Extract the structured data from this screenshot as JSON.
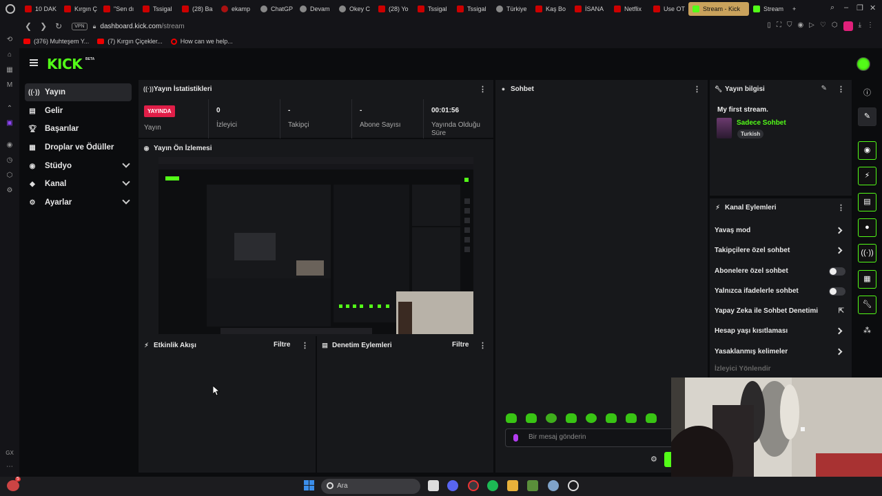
{
  "browser": {
    "tabs": [
      {
        "label": "10 DAK",
        "fav": "youtube"
      },
      {
        "label": "Kırgın Ç",
        "fav": "youtube"
      },
      {
        "label": "\"Sen dı",
        "fav": "youtube"
      },
      {
        "label": "Tssigal",
        "fav": "youtube"
      },
      {
        "label": "(28) Ba",
        "fav": "youtube"
      },
      {
        "label": "ekamp",
        "fav": "dark"
      },
      {
        "label": "ChatGP",
        "fav": "grey"
      },
      {
        "label": "Devam",
        "fav": "google"
      },
      {
        "label": "Okey C",
        "fav": "grey"
      },
      {
        "label": "(28) Yo",
        "fav": "youtube"
      },
      {
        "label": "Tssigal",
        "fav": "youtube"
      },
      {
        "label": "Tssigal",
        "fav": "youtube"
      },
      {
        "label": "Türkiye",
        "fav": "grey"
      },
      {
        "label": "Kaş Bo",
        "fav": "red"
      },
      {
        "label": "İSANA",
        "fav": "red"
      },
      {
        "label": "Netflix",
        "fav": "red"
      },
      {
        "label": "Use OT",
        "fav": "gmail"
      }
    ],
    "active_tab": "Stream - Kick",
    "extra_tab": "Stream",
    "vpn_label": "VPN",
    "url_domain": "dashboard.kick.com",
    "url_path": "/stream",
    "bookmarks": [
      {
        "label": "(376) Muhteşem Y..."
      },
      {
        "label": "(7) Kırgın Çiçekler..."
      },
      {
        "label": "How can we help..."
      }
    ]
  },
  "header": {
    "logo": "KICK",
    "beta": "BETA"
  },
  "nav": {
    "items": [
      {
        "label": "Yayın",
        "icon": "broadcast-icon"
      },
      {
        "label": "Gelir",
        "icon": "revenue-icon"
      },
      {
        "label": "Başarılar",
        "icon": "trophy-icon"
      },
      {
        "label": "Droplar ve Ödüller",
        "icon": "gift-icon"
      },
      {
        "label": "Stüdyo",
        "icon": "studio-icon"
      },
      {
        "label": "Kanal",
        "icon": "channel-icon"
      },
      {
        "label": "Ayarlar",
        "icon": "settings-icon"
      }
    ]
  },
  "stats": {
    "title": "Yayın İstatistikleri",
    "live_badge": "YAYINDA",
    "live_label": "Yayın",
    "viewers_value": "0",
    "viewers_label": "İzleyici",
    "followers_value": "-",
    "followers_label": "Takipçi",
    "subs_value": "-",
    "subs_label": "Abone Sayısı",
    "duration_value": "00:01:56",
    "duration_label": "Yayında Olduğu Süre"
  },
  "preview": {
    "title": "Yayın Ön İzlemesi"
  },
  "activity": {
    "title": "Etkinlik Akışı",
    "filter": "Filtre"
  },
  "moderation": {
    "title": "Denetim Eylemleri",
    "filter": "Filtre"
  },
  "chat": {
    "title": "Sohbet",
    "placeholder": "Bir mesaj gönderin"
  },
  "stream_info": {
    "title": "Yayın bilgisi",
    "stream_title": "My first stream.",
    "category": "Sadece Sohbet",
    "tag": "Turkish",
    "category_color": "#53fc18"
  },
  "channel_actions": {
    "title": "Kanal Eylemleri",
    "rows": [
      {
        "label": "Yavaş mod",
        "control": "arrow"
      },
      {
        "label": "Takipçilere özel sohbet",
        "control": "arrow"
      },
      {
        "label": "Abonelere özel sohbet",
        "control": "toggle"
      },
      {
        "label": "Yalnızca ifadelerle sohbet",
        "control": "toggle"
      },
      {
        "label": "Yapay Zeka ile Sohbet Denetimi",
        "control": "external"
      },
      {
        "label": "Hesap yaşı kısıtlaması",
        "control": "arrow"
      },
      {
        "label": "Yasaklanmış kelimeler",
        "control": "arrow"
      },
      {
        "label": "İzleyici Yönlendir",
        "control": "none"
      }
    ]
  },
  "taskbar": {
    "search_label": "Ara",
    "notification_count": "5"
  },
  "colors": {
    "accent": "#53fc18",
    "live": "#e01e48"
  }
}
